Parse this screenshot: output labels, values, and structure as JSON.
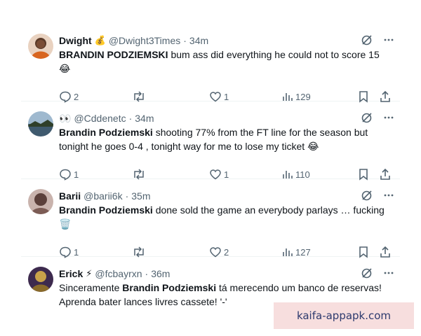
{
  "tweets": [
    {
      "name": "Dwight",
      "badge": "💰",
      "handle": "@Dwight3Times",
      "time": "34m",
      "mention": "BRANDIN PODZIEMSKI",
      "text": " bum ass did everything he could not to score 15",
      "line2": "😂",
      "replies": "2",
      "reposts": "",
      "likes": "1",
      "views": "129",
      "avatar_color": "#b4541f"
    },
    {
      "name": "👀",
      "badge": "",
      "handle": "@Cddenetc",
      "time": "34m",
      "mention": "Brandin Podziemski",
      "text": " shooting 77% from the FT line for the season but tonight he goes 0-4 , tonight way for me to lose my ticket 😂",
      "line2": "",
      "replies": "1",
      "reposts": "",
      "likes": "1",
      "views": "110",
      "avatar_color": "#6d8ca8"
    },
    {
      "name": "Barii",
      "badge": "",
      "handle": "@barii6k",
      "time": "35m",
      "mention": "Brandin Podziemski",
      "text": " done sold the game an everybody parlays … fucking 🗑️",
      "line2": "",
      "replies": "1",
      "reposts": "",
      "likes": "2",
      "views": "127",
      "avatar_color": "#8a6e68"
    },
    {
      "name": "Erick",
      "badge": "⚡",
      "handle": "@fcbayrxn",
      "time": "36m",
      "pre": "Sinceramente ",
      "mention": "Brandin Podziemski",
      "text": " tá merecendo um banco de reservas! Aprenda bater lances livres cassete! '-'",
      "line2": "",
      "replies": "",
      "reposts": "",
      "likes": "",
      "views": "",
      "avatar_color": "#5a3a7a"
    }
  ],
  "watermark": "kaifa-appapk.com",
  "separator": "·"
}
